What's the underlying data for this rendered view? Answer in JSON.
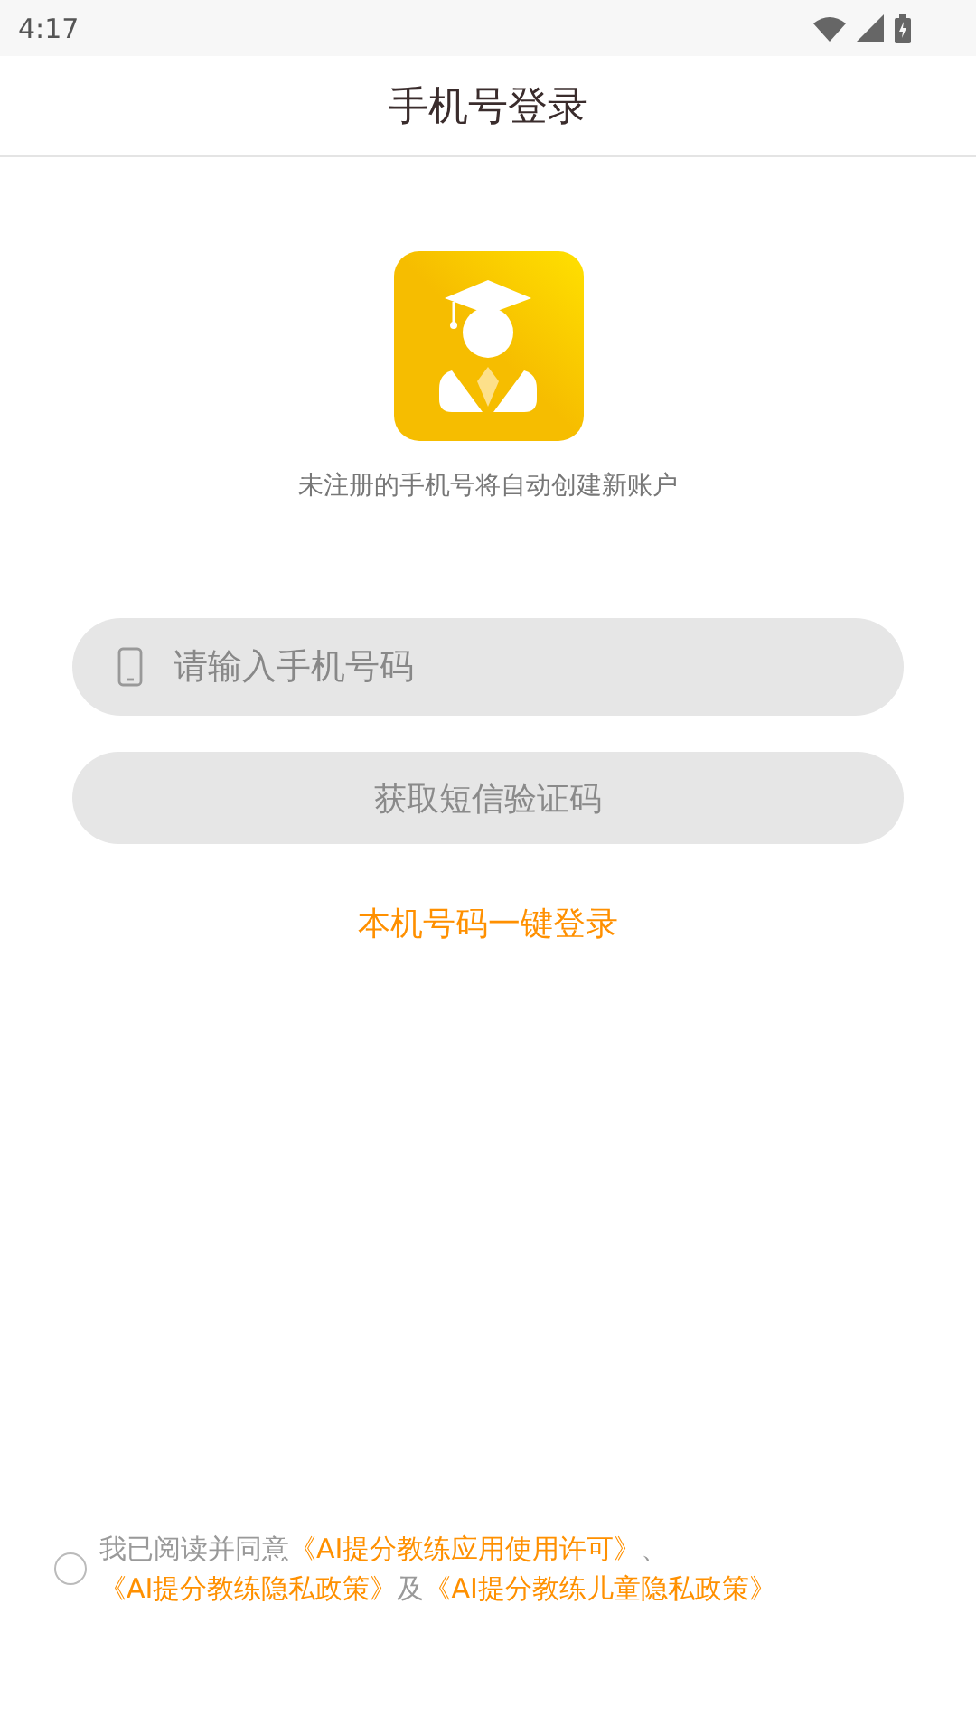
{
  "status_bar": {
    "time": "4:17"
  },
  "header": {
    "title": "手机号登录"
  },
  "logo": {
    "caption": "未注册的手机号将自动创建新账户"
  },
  "phone_field": {
    "placeholder": "请输入手机号码"
  },
  "sms_button": {
    "label": "获取短信验证码",
    "disabled": true
  },
  "one_tap_link": {
    "label": "本机号码一键登录"
  },
  "agreement": {
    "checked": false,
    "parts": [
      {
        "kind": "text",
        "text": "我已阅读并同意"
      },
      {
        "kind": "link",
        "text": "《AI提分教练应用使用许可》"
      },
      {
        "kind": "text",
        "text": "、"
      },
      {
        "kind": "link",
        "text": "《AI提分教练隐私政策》"
      },
      {
        "kind": "text",
        "text": "及"
      },
      {
        "kind": "link",
        "text": "《AI提分教练儿童隐私政策》"
      }
    ]
  }
}
